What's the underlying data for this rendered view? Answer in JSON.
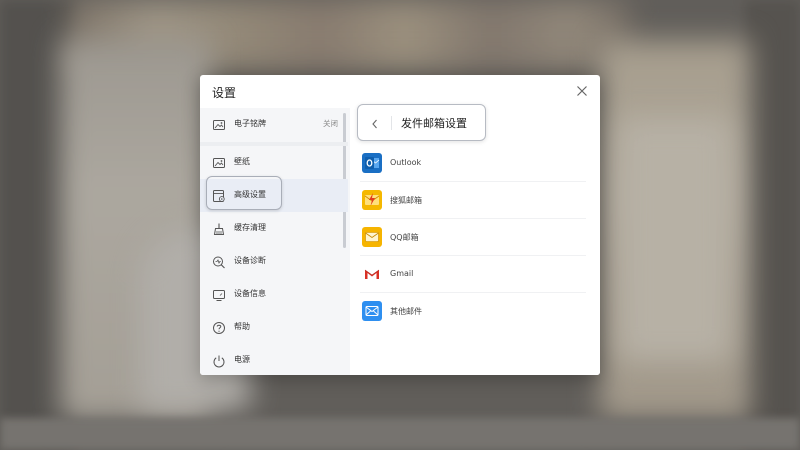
{
  "dialog": {
    "title": "设置",
    "close_icon": "close-icon"
  },
  "sidebar": {
    "items": [
      {
        "label": "电子铭牌",
        "status": "关闭",
        "icon": "nameplate-icon"
      },
      {
        "label": "壁纸",
        "icon": "wallpaper-icon"
      },
      {
        "label": "高级设置",
        "icon": "advanced-settings-icon",
        "active": true
      },
      {
        "label": "缓存清理",
        "icon": "broom-icon"
      },
      {
        "label": "设备诊断",
        "icon": "diagnostic-icon"
      },
      {
        "label": "设备信息",
        "icon": "monitor-icon"
      },
      {
        "label": "帮助",
        "icon": "help-icon"
      },
      {
        "label": "电源",
        "icon": "power-icon"
      }
    ]
  },
  "content": {
    "title": "发件邮箱设置",
    "back_icon": "chevron-left-icon",
    "mail_providers": [
      {
        "label": "Outlook",
        "icon": "outlook-icon",
        "color": "#1a6fc4"
      },
      {
        "label": "搜狐邮箱",
        "icon": "sohu-mail-icon",
        "color": "#f5b800"
      },
      {
        "label": "QQ邮箱",
        "icon": "qq-mail-icon",
        "color": "#f6b400"
      },
      {
        "label": "Gmail",
        "icon": "gmail-icon",
        "color": "#d93025"
      },
      {
        "label": "其他邮件",
        "icon": "envelope-icon",
        "color": "#2e8ff0"
      }
    ]
  }
}
